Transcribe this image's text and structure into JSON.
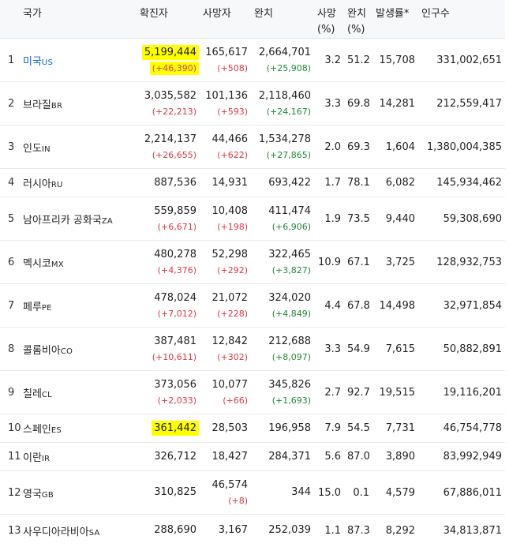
{
  "headers": {
    "country": "국가",
    "confirmed": "확진자",
    "deaths": "사망자",
    "recovered": "완치",
    "death_rate": "사망(%)",
    "recovery_rate": "완치(%)",
    "incidence": "발생률*",
    "population": "인구수"
  },
  "rows": [
    {
      "rank": "1",
      "name": "미국",
      "code": "US",
      "link": true,
      "confirmed": "5,199,444",
      "confirmed_delta": "(+46,390)",
      "deaths": "165,617",
      "deaths_delta": "(+508)",
      "recovered": "2,664,701",
      "recovered_delta": "(+25,908)",
      "death_rate": "3.2",
      "recovery_rate": "51.2",
      "incidence": "15,708",
      "population": "331,002,651"
    },
    {
      "rank": "2",
      "name": "브라질",
      "code": "BR",
      "confirmed": "3,035,582",
      "confirmed_delta": "(+22,213)",
      "deaths": "101,136",
      "deaths_delta": "(+593)",
      "recovered": "2,118,460",
      "recovered_delta": "(+24,167)",
      "death_rate": "3.3",
      "recovery_rate": "69.8",
      "incidence": "14,281",
      "population": "212,559,417"
    },
    {
      "rank": "3",
      "name": "인도",
      "code": "IN",
      "confirmed": "2,214,137",
      "confirmed_delta": "(+26,655)",
      "deaths": "44,466",
      "deaths_delta": "(+622)",
      "recovered": "1,534,278",
      "recovered_delta": "(+27,865)",
      "death_rate": "2.0",
      "recovery_rate": "69.3",
      "incidence": "1,604",
      "population": "1,380,004,385"
    },
    {
      "rank": "4",
      "name": "러시아",
      "code": "RU",
      "confirmed": "887,536",
      "deaths": "14,931",
      "recovered": "693,422",
      "death_rate": "1.7",
      "recovery_rate": "78.1",
      "incidence": "6,082",
      "population": "145,934,462"
    },
    {
      "rank": "5",
      "name": "남아프리카 공화국",
      "code": "ZA",
      "confirmed": "559,859",
      "confirmed_delta": "(+6,671)",
      "deaths": "10,408",
      "deaths_delta": "(+198)",
      "recovered": "411,474",
      "recovered_delta": "(+6,906)",
      "death_rate": "1.9",
      "recovery_rate": "73.5",
      "incidence": "9,440",
      "population": "59,308,690"
    },
    {
      "rank": "6",
      "name": "멕시코",
      "code": "MX",
      "confirmed": "480,278",
      "confirmed_delta": "(+4,376)",
      "deaths": "52,298",
      "deaths_delta": "(+292)",
      "recovered": "322,465",
      "recovered_delta": "(+3,827)",
      "death_rate": "10.9",
      "recovery_rate": "67.1",
      "incidence": "3,725",
      "population": "128,932,753"
    },
    {
      "rank": "7",
      "name": "페루",
      "code": "PE",
      "confirmed": "478,024",
      "confirmed_delta": "(+7,012)",
      "deaths": "21,072",
      "deaths_delta": "(+228)",
      "recovered": "324,020",
      "recovered_delta": "(+4,849)",
      "death_rate": "4.4",
      "recovery_rate": "67.8",
      "incidence": "14,498",
      "population": "32,971,854"
    },
    {
      "rank": "8",
      "name": "콜롬비아",
      "code": "CO",
      "confirmed": "387,481",
      "confirmed_delta": "(+10,611)",
      "deaths": "12,842",
      "deaths_delta": "(+302)",
      "recovered": "212,688",
      "recovered_delta": "(+8,097)",
      "death_rate": "3.3",
      "recovery_rate": "54.9",
      "incidence": "7,615",
      "population": "50,882,891"
    },
    {
      "rank": "9",
      "name": "칠레",
      "code": "CL",
      "confirmed": "373,056",
      "confirmed_delta": "(+2,033)",
      "deaths": "10,077",
      "deaths_delta": "(+66)",
      "recovered": "345,826",
      "recovered_delta": "(+1,693)",
      "death_rate": "2.7",
      "recovery_rate": "92.7",
      "incidence": "19,515",
      "population": "19,116,201"
    },
    {
      "rank": "10",
      "name": "스페인",
      "code": "ES",
      "confirmed": "361,442",
      "deaths": "28,503",
      "recovered": "196,958",
      "death_rate": "7.9",
      "recovery_rate": "54.5",
      "incidence": "7,731",
      "population": "46,754,778"
    },
    {
      "rank": "11",
      "name": "이란",
      "code": "IR",
      "confirmed": "326,712",
      "deaths": "18,427",
      "recovered": "284,371",
      "death_rate": "5.6",
      "recovery_rate": "87.0",
      "incidence": "3,890",
      "population": "83,992,949"
    },
    {
      "rank": "12",
      "name": "영국",
      "code": "GB",
      "confirmed": "310,825",
      "deaths": "46,574",
      "deaths_delta": "(+8)",
      "recovered": "344",
      "death_rate": "15.0",
      "recovery_rate": "0.1",
      "incidence": "4,579",
      "population": "67,886,011"
    },
    {
      "rank": "13",
      "name": "사우디아라비아",
      "code": "SA",
      "confirmed": "288,690",
      "deaths": "3,167",
      "recovered": "252,039",
      "death_rate": "1.1",
      "recovery_rate": "87.3",
      "incidence": "8,292",
      "population": "34,813,871"
    }
  ],
  "colors": {
    "increase": "#d73a49",
    "recovered_increase": "#22863a",
    "link": "#0366d6",
    "highlight": "#ffff00",
    "header_bg": "#f6f8fa"
  }
}
